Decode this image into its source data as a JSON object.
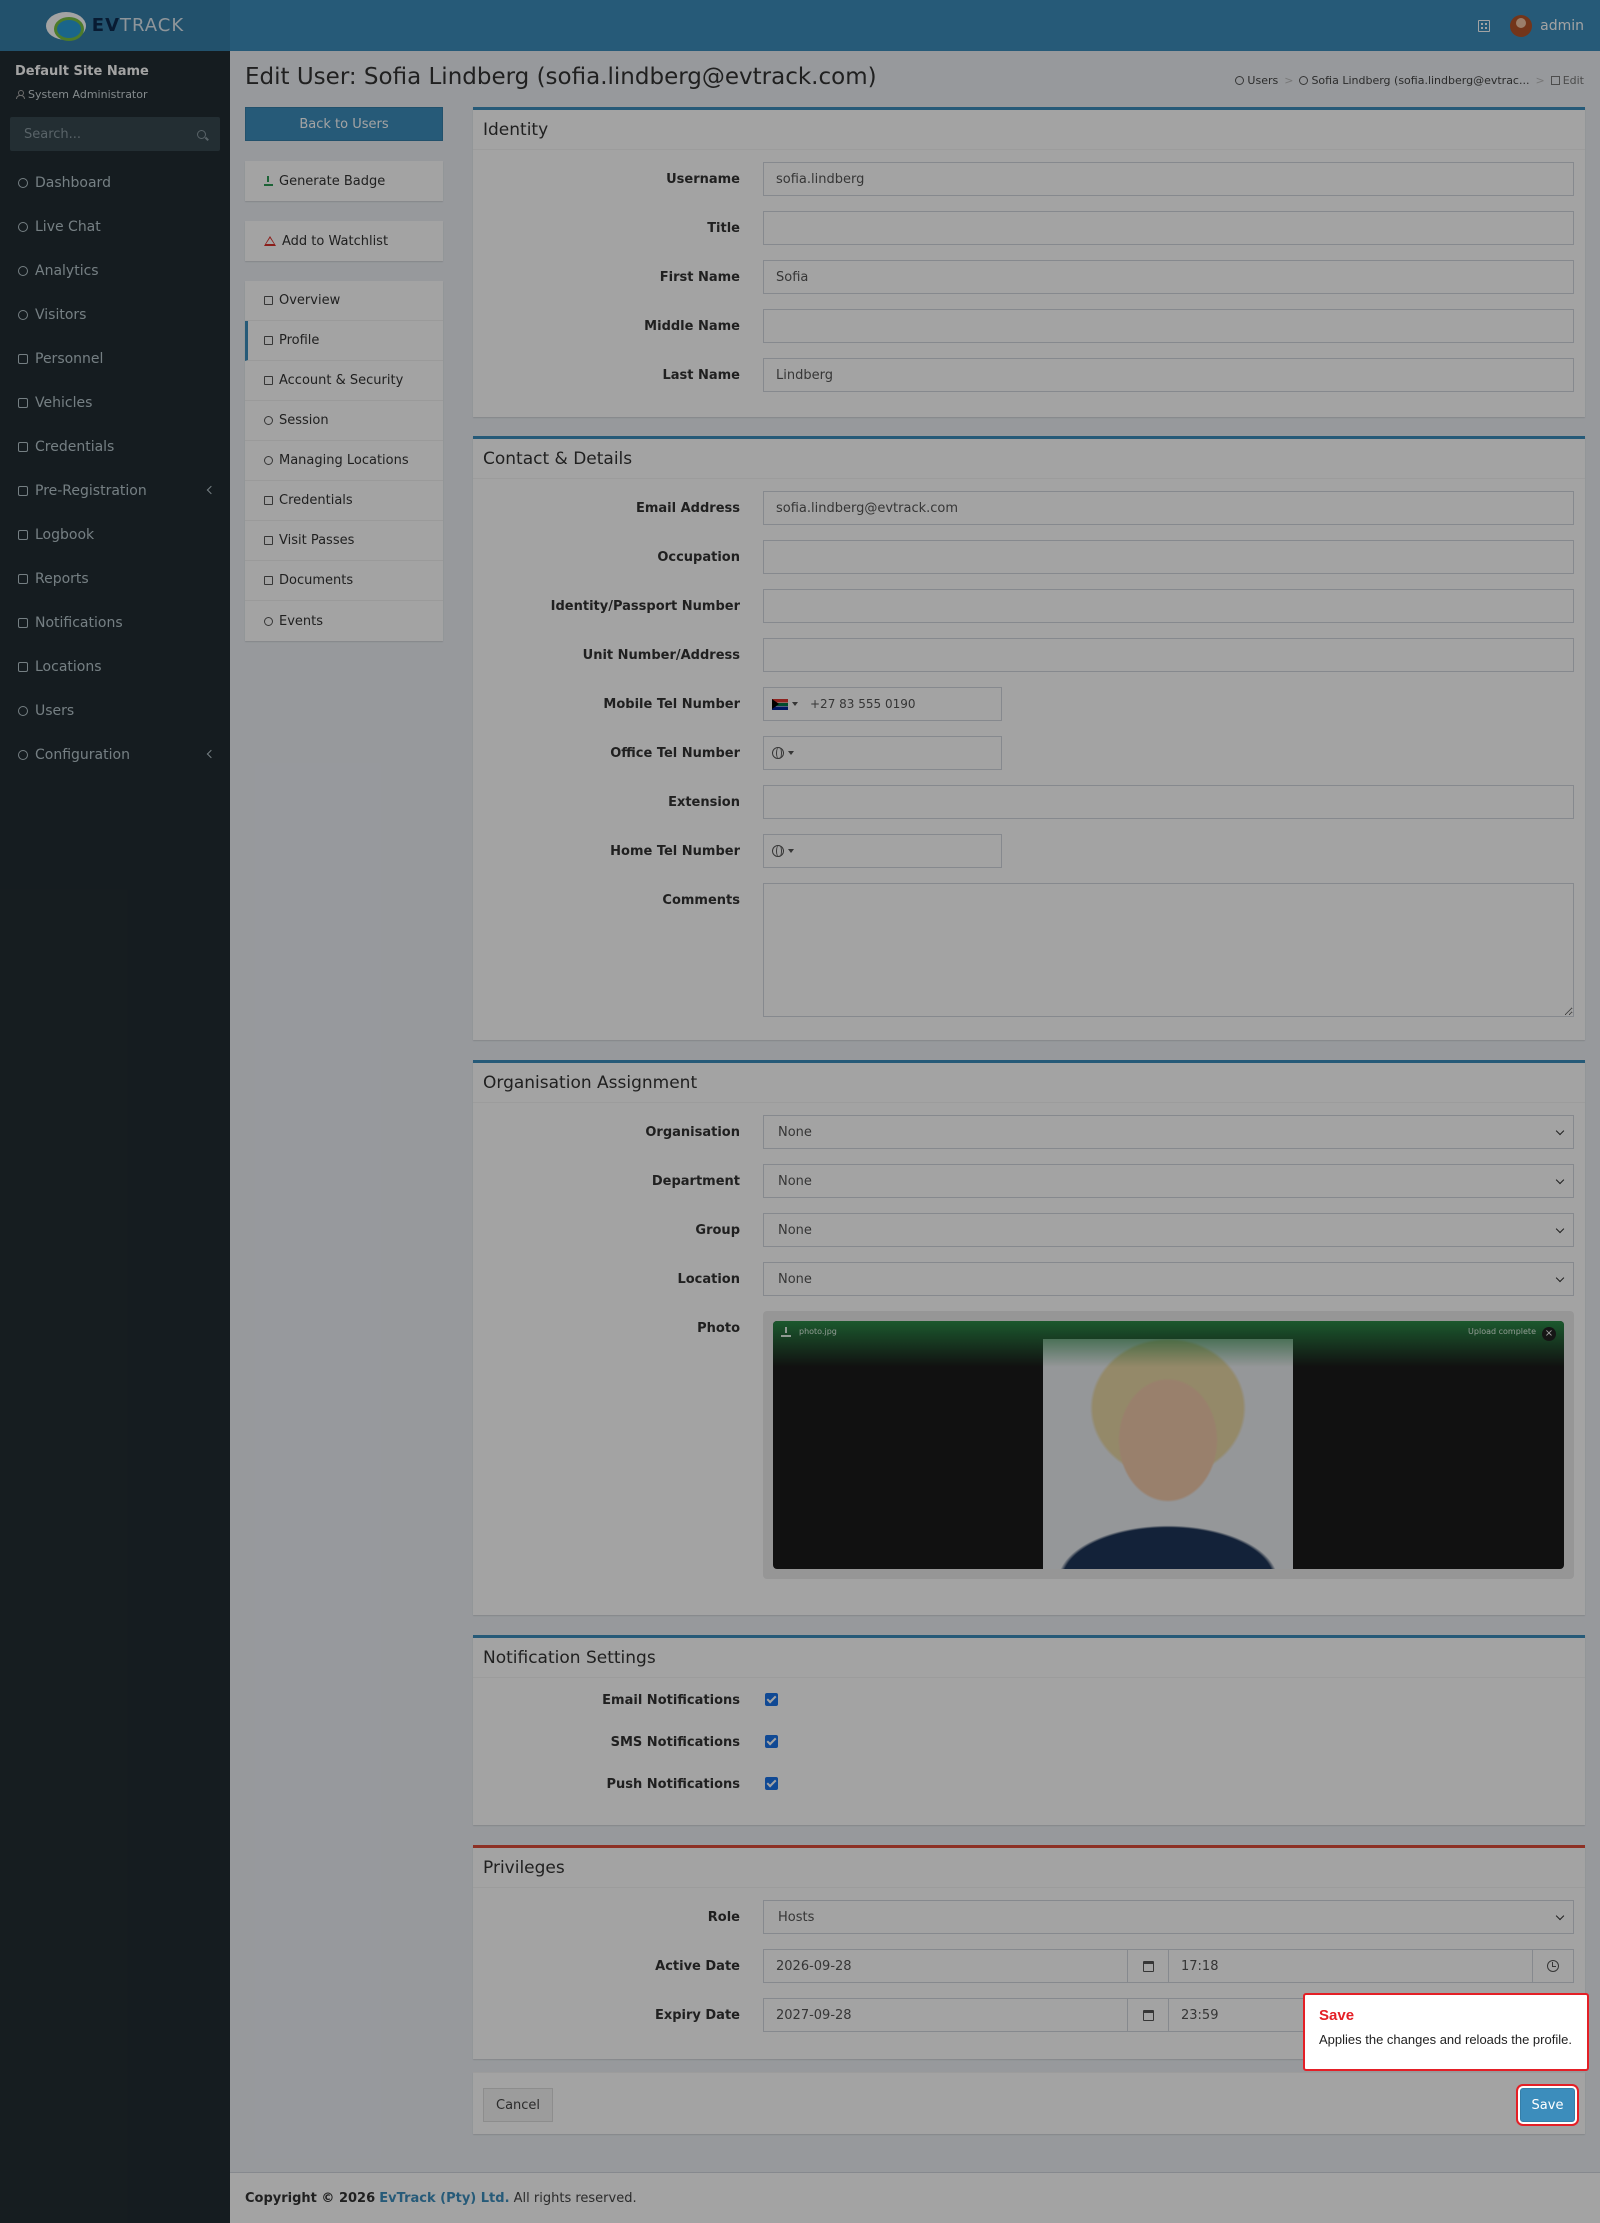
{
  "header": {
    "brand_left": "EV",
    "brand_right": "TRACK",
    "username": "admin"
  },
  "sidebar": {
    "site_name": "Default Site Name",
    "site_role": "System Administrator",
    "search_placeholder": "Search...",
    "items": [
      {
        "label": "Dashboard"
      },
      {
        "label": "Live Chat"
      },
      {
        "label": "Analytics"
      },
      {
        "label": "Visitors"
      },
      {
        "label": "Personnel"
      },
      {
        "label": "Vehicles"
      },
      {
        "label": "Credentials"
      },
      {
        "label": "Pre-Registration"
      },
      {
        "label": "Logbook"
      },
      {
        "label": "Reports"
      },
      {
        "label": "Notifications"
      },
      {
        "label": "Locations"
      },
      {
        "label": "Users"
      },
      {
        "label": "Configuration"
      }
    ]
  },
  "page": {
    "title": "Edit User: Sofia Lindberg (sofia.lindberg@evtrack.com)",
    "breadcrumb": [
      "Users",
      "Sofia Lindberg (sofia.lindberg@evtrac...",
      "Edit"
    ]
  },
  "left": {
    "back_button": "Back to Users",
    "generate_badge": "Generate Badge",
    "add_watchlist": "Add to Watchlist",
    "menu": [
      "Overview",
      "Profile",
      "Account & Security",
      "Session",
      "Managing Locations",
      "Credentials",
      "Visit Passes",
      "Documents",
      "Events"
    ]
  },
  "identity": {
    "title": "Identity",
    "labels": {
      "username": "Username",
      "title": "Title",
      "first_name": "First Name",
      "middle_name": "Middle Name",
      "last_name": "Last Name"
    },
    "values": {
      "username": "sofia.lindberg",
      "title": "",
      "first_name": "Sofia",
      "middle_name": "",
      "last_name": "Lindberg"
    }
  },
  "contact": {
    "title": "Contact & Details",
    "labels": {
      "email": "Email Address",
      "occupation": "Occupation",
      "id_number": "Identity/Passport Number",
      "unit": "Unit Number/Address",
      "mobile": "Mobile Tel Number",
      "office": "Office Tel Number",
      "extension": "Extension",
      "home": "Home Tel Number",
      "comments": "Comments"
    },
    "values": {
      "email": "sofia.lindberg@evtrack.com",
      "mobile": "+27 83 555 0190"
    }
  },
  "organisation": {
    "title": "Organisation Assignment",
    "labels": {
      "organisation": "Organisation",
      "department": "Department",
      "group": "Group",
      "location": "Location",
      "photo": "Photo"
    },
    "values": {
      "organisation": "None",
      "department": "None",
      "group": "None",
      "location": "None"
    },
    "photo": {
      "file_name": "photo.jpg",
      "status": "Upload complete",
      "close": "×"
    }
  },
  "notifications": {
    "title": "Notification Settings",
    "labels": {
      "email": "Email Notifications",
      "sms": "SMS Notifications",
      "push": "Push Notifications"
    },
    "checked": {
      "email": true,
      "sms": true,
      "push": true
    }
  },
  "privileges": {
    "title": "Privileges",
    "labels": {
      "role": "Role",
      "active_date": "Active Date",
      "expiry_date": "Expiry Date"
    },
    "values": {
      "role": "Hosts",
      "active_date": "2026-09-28",
      "active_time": "17:18",
      "expiry_date": "2027-09-28",
      "expiry_time": "23:59"
    }
  },
  "actions": {
    "cancel": "Cancel",
    "save": "Save"
  },
  "tooltip": {
    "title": "Save",
    "body": "Applies the changes and reloads the profile."
  },
  "footer": {
    "prefix": "Copyright © 2026",
    "company": "EvTrack (Pty) Ltd.",
    "suffix": "All rights reserved."
  },
  "colors": {
    "primary": "#3c8dbc",
    "sidebar": "#222d32",
    "danger": "#dd4b39",
    "highlight": "#e41f26"
  }
}
